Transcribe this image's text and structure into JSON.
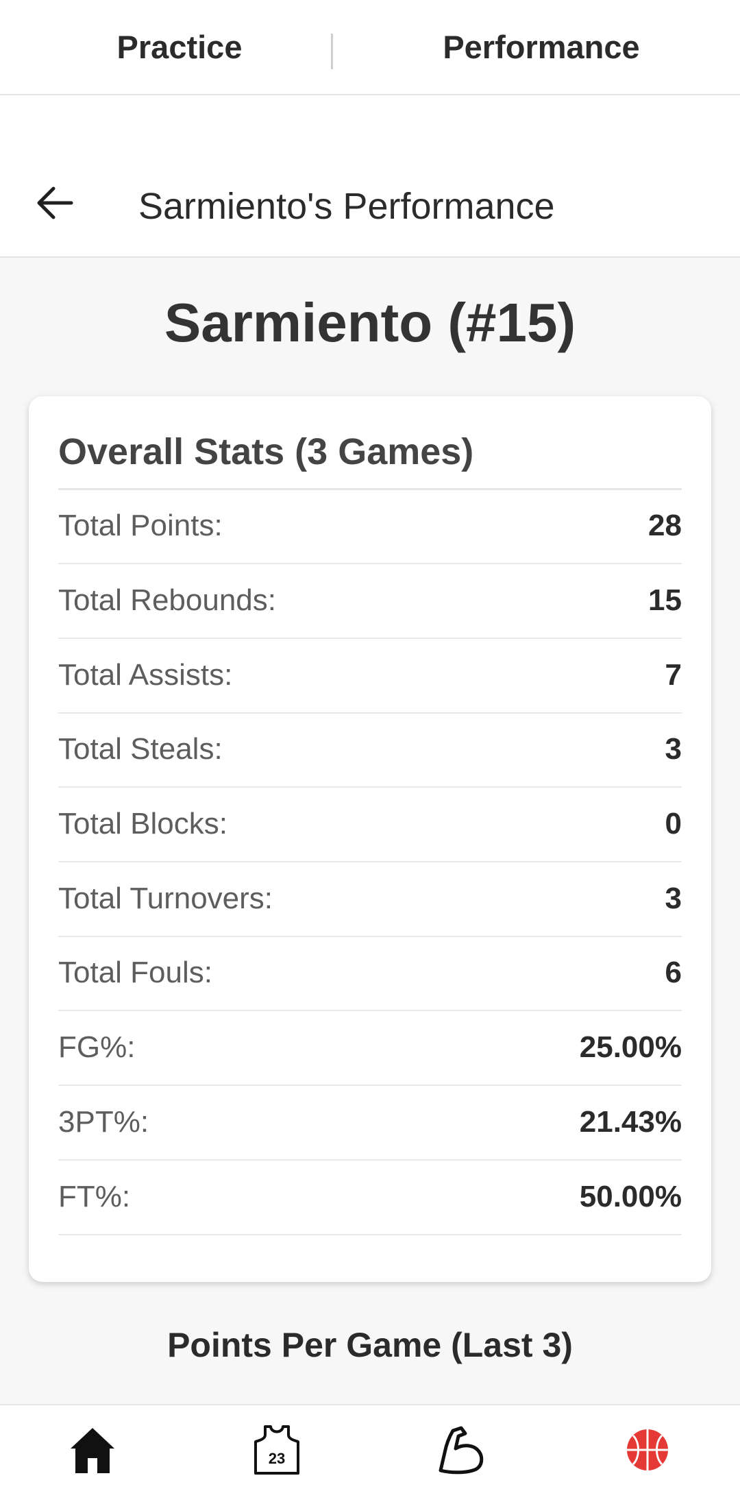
{
  "top_tabs": {
    "practice": "Practice",
    "performance": "Performance"
  },
  "header": {
    "title": "Sarmiento's Performance",
    "back_icon": "arrow-left-icon"
  },
  "player": {
    "heading": "Sarmiento (#15)"
  },
  "overall_stats": {
    "title": "Overall Stats (3 Games)",
    "rows": [
      {
        "label": "Total Points:",
        "value": "28"
      },
      {
        "label": "Total Rebounds:",
        "value": "15"
      },
      {
        "label": "Total Assists:",
        "value": "7"
      },
      {
        "label": "Total Steals:",
        "value": "3"
      },
      {
        "label": "Total Blocks:",
        "value": "0"
      },
      {
        "label": "Total Turnovers:",
        "value": "3"
      },
      {
        "label": "Total Fouls:",
        "value": "6"
      },
      {
        "label": "FG%:",
        "value": "25.00%"
      },
      {
        "label": "3PT%:",
        "value": "21.43%"
      },
      {
        "label": "FT%:",
        "value": "50.00%"
      }
    ]
  },
  "chart_section": {
    "title": "Points Per Game (Last 3)"
  },
  "bottom_nav": {
    "items": [
      {
        "icon": "home-icon"
      },
      {
        "icon": "jersey-icon",
        "number": "23"
      },
      {
        "icon": "flexed-arm-icon"
      },
      {
        "icon": "basketball-icon",
        "active_color": "#e53935"
      }
    ]
  }
}
